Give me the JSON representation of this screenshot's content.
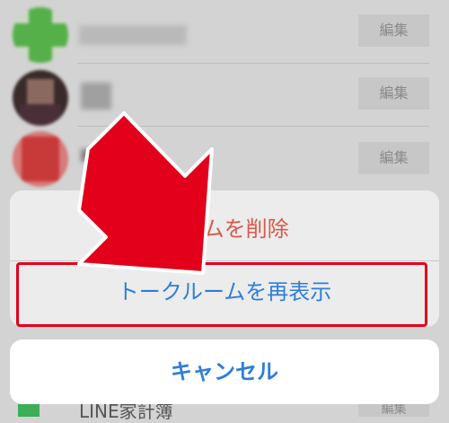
{
  "chat_list": {
    "rows": [
      {
        "edit_label": "編集"
      },
      {
        "edit_label": "編集"
      },
      {
        "edit_label": "編集"
      }
    ],
    "bottom_item": {
      "name": "LINE家計簿",
      "edit_label": "編集"
    }
  },
  "action_sheet": {
    "delete_label": "ルームを削除",
    "restore_label": "トークルームを再表示"
  },
  "cancel_label": "キャンセル",
  "colors": {
    "accent_blue": "#2f7ed8",
    "destructive_red": "#d75a4a",
    "annotation_red": "#e3001b"
  }
}
